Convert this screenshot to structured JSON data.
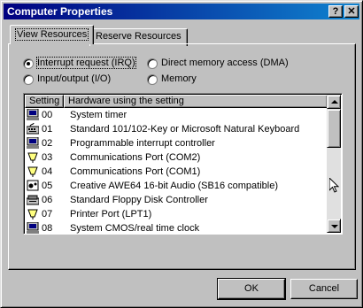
{
  "window": {
    "title": "Computer Properties",
    "help_label": "?",
    "close_label": "✕"
  },
  "tabs": [
    {
      "label": "View Resources",
      "active": true
    },
    {
      "label": "Reserve Resources",
      "active": false
    }
  ],
  "resource_types": [
    {
      "label": "Interrupt request (IRQ)",
      "selected": true
    },
    {
      "label": "Input/output (I/O)",
      "selected": false
    },
    {
      "label": "Direct memory access (DMA)",
      "selected": false
    },
    {
      "label": "Memory",
      "selected": false
    }
  ],
  "list": {
    "columns": [
      "Setting",
      "Hardware using the setting"
    ],
    "rows": [
      {
        "setting": "00",
        "hardware": "System timer",
        "icon": "computer-icon"
      },
      {
        "setting": "01",
        "hardware": "Standard 101/102-Key or Microsoft Natural Keyboard",
        "icon": "keyboard-icon"
      },
      {
        "setting": "02",
        "hardware": "Programmable interrupt controller",
        "icon": "computer-icon"
      },
      {
        "setting": "03",
        "hardware": "Communications Port (COM2)",
        "icon": "port-icon"
      },
      {
        "setting": "04",
        "hardware": "Communications Port (COM1)",
        "icon": "port-icon"
      },
      {
        "setting": "05",
        "hardware": "Creative AWE64 16-bit Audio (SB16 compatible)",
        "icon": "sound-icon"
      },
      {
        "setting": "06",
        "hardware": "Standard Floppy Disk Controller",
        "icon": "floppy-icon"
      },
      {
        "setting": "07",
        "hardware": "Printer Port (LPT1)",
        "icon": "port-icon"
      },
      {
        "setting": "08",
        "hardware": "System CMOS/real time clock",
        "icon": "computer-icon"
      }
    ]
  },
  "buttons": {
    "ok": "OK",
    "cancel": "Cancel"
  }
}
